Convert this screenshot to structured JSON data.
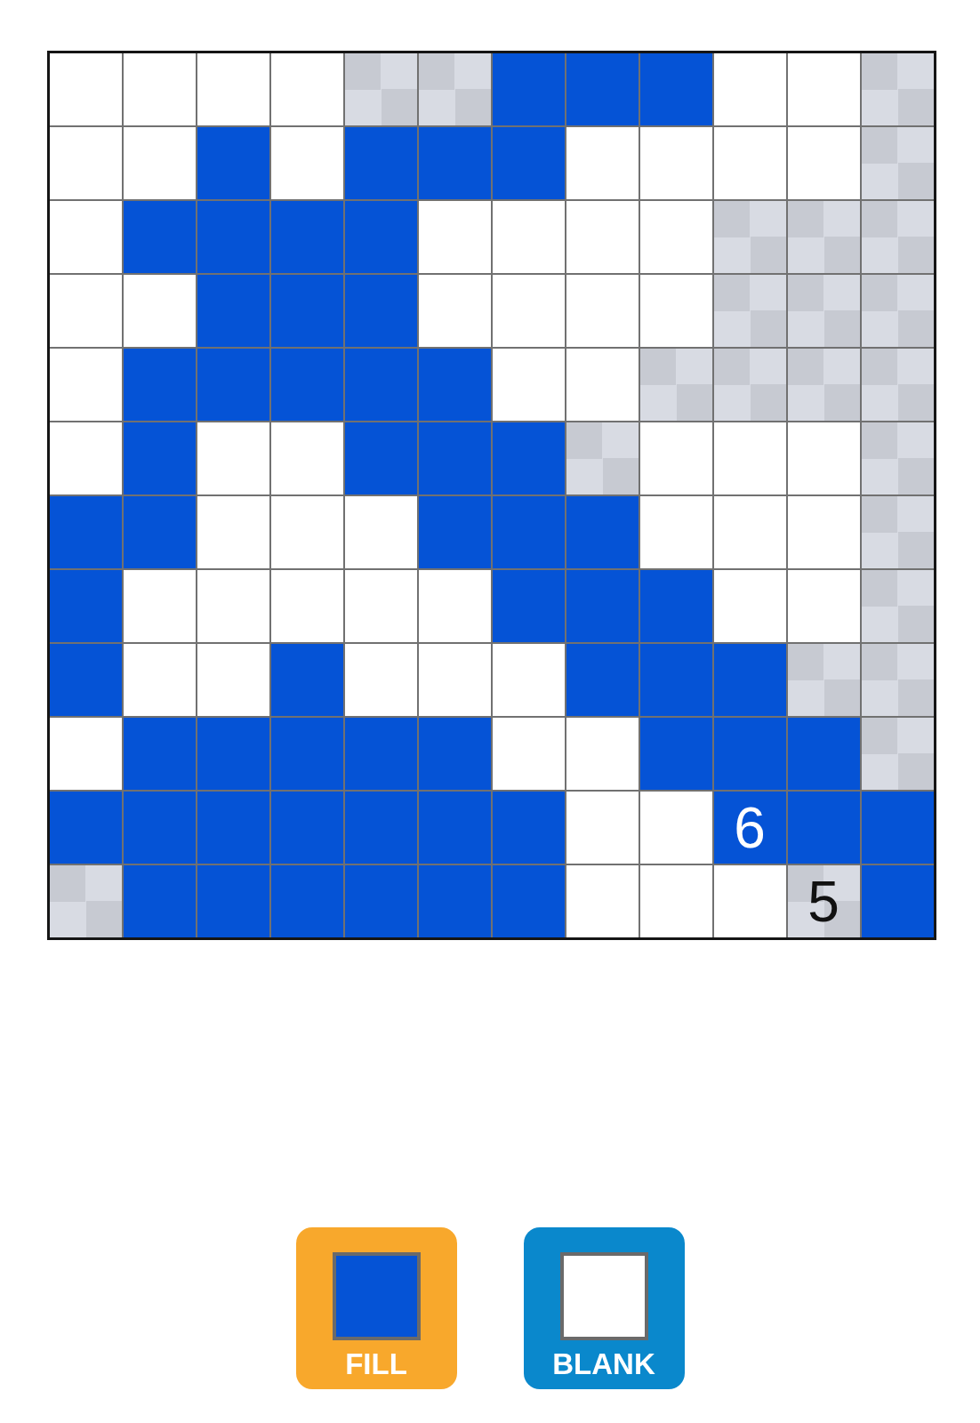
{
  "grid": {
    "rows": [
      {
        "cells": [
          {
            "kind": "empty"
          },
          {
            "kind": "empty"
          },
          {
            "kind": "empty"
          },
          {
            "kind": "empty"
          },
          {
            "kind": "unknown"
          },
          {
            "kind": "unknown"
          },
          {
            "kind": "filled"
          },
          {
            "kind": "filled"
          },
          {
            "kind": "filled"
          },
          {
            "kind": "empty"
          },
          {
            "kind": "empty"
          },
          {
            "kind": "unknown"
          }
        ]
      },
      {
        "cells": [
          {
            "kind": "empty"
          },
          {
            "kind": "empty"
          },
          {
            "kind": "filled"
          },
          {
            "kind": "empty"
          },
          {
            "kind": "filled"
          },
          {
            "kind": "filled"
          },
          {
            "kind": "filled"
          },
          {
            "kind": "empty"
          },
          {
            "kind": "empty"
          },
          {
            "kind": "empty"
          },
          {
            "kind": "empty"
          },
          {
            "kind": "unknown"
          }
        ]
      },
      {
        "cells": [
          {
            "kind": "empty"
          },
          {
            "kind": "filled"
          },
          {
            "kind": "filled"
          },
          {
            "kind": "filled"
          },
          {
            "kind": "filled"
          },
          {
            "kind": "empty"
          },
          {
            "kind": "empty"
          },
          {
            "kind": "empty"
          },
          {
            "kind": "empty"
          },
          {
            "kind": "unknown"
          },
          {
            "kind": "unknown"
          },
          {
            "kind": "unknown"
          }
        ]
      },
      {
        "cells": [
          {
            "kind": "empty"
          },
          {
            "kind": "empty"
          },
          {
            "kind": "filled"
          },
          {
            "kind": "filled"
          },
          {
            "kind": "filled"
          },
          {
            "kind": "empty"
          },
          {
            "kind": "empty"
          },
          {
            "kind": "empty"
          },
          {
            "kind": "empty"
          },
          {
            "kind": "unknown"
          },
          {
            "kind": "unknown"
          },
          {
            "kind": "unknown"
          }
        ]
      },
      {
        "cells": [
          {
            "kind": "empty"
          },
          {
            "kind": "filled"
          },
          {
            "kind": "filled"
          },
          {
            "kind": "filled"
          },
          {
            "kind": "filled"
          },
          {
            "kind": "filled"
          },
          {
            "kind": "empty"
          },
          {
            "kind": "empty"
          },
          {
            "kind": "unknown"
          },
          {
            "kind": "unknown"
          },
          {
            "kind": "unknown"
          },
          {
            "kind": "unknown"
          }
        ]
      },
      {
        "cells": [
          {
            "kind": "empty"
          },
          {
            "kind": "filled"
          },
          {
            "kind": "empty"
          },
          {
            "kind": "empty"
          },
          {
            "kind": "filled"
          },
          {
            "kind": "filled"
          },
          {
            "kind": "filled"
          },
          {
            "kind": "unknown"
          },
          {
            "kind": "empty"
          },
          {
            "kind": "empty"
          },
          {
            "kind": "empty"
          },
          {
            "kind": "unknown"
          }
        ]
      },
      {
        "cells": [
          {
            "kind": "filled"
          },
          {
            "kind": "filled"
          },
          {
            "kind": "empty"
          },
          {
            "kind": "empty"
          },
          {
            "kind": "empty"
          },
          {
            "kind": "filled"
          },
          {
            "kind": "filled"
          },
          {
            "kind": "filled"
          },
          {
            "kind": "empty"
          },
          {
            "kind": "empty"
          },
          {
            "kind": "empty"
          },
          {
            "kind": "unknown"
          }
        ]
      },
      {
        "cells": [
          {
            "kind": "filled"
          },
          {
            "kind": "empty"
          },
          {
            "kind": "empty"
          },
          {
            "kind": "empty"
          },
          {
            "kind": "empty"
          },
          {
            "kind": "empty"
          },
          {
            "kind": "filled"
          },
          {
            "kind": "filled"
          },
          {
            "kind": "filled"
          },
          {
            "kind": "empty"
          },
          {
            "kind": "empty"
          },
          {
            "kind": "unknown"
          }
        ]
      },
      {
        "cells": [
          {
            "kind": "filled"
          },
          {
            "kind": "empty"
          },
          {
            "kind": "empty"
          },
          {
            "kind": "filled"
          },
          {
            "kind": "empty"
          },
          {
            "kind": "empty"
          },
          {
            "kind": "empty"
          },
          {
            "kind": "filled"
          },
          {
            "kind": "filled"
          },
          {
            "kind": "filled"
          },
          {
            "kind": "unknown"
          },
          {
            "kind": "unknown"
          }
        ]
      },
      {
        "cells": [
          {
            "kind": "empty"
          },
          {
            "kind": "filled"
          },
          {
            "kind": "filled"
          },
          {
            "kind": "filled"
          },
          {
            "kind": "filled"
          },
          {
            "kind": "filled"
          },
          {
            "kind": "empty"
          },
          {
            "kind": "empty"
          },
          {
            "kind": "filled"
          },
          {
            "kind": "filled"
          },
          {
            "kind": "filled"
          },
          {
            "kind": "unknown"
          }
        ]
      },
      {
        "cells": [
          {
            "kind": "filled"
          },
          {
            "kind": "filled"
          },
          {
            "kind": "filled"
          },
          {
            "kind": "filled"
          },
          {
            "kind": "filled"
          },
          {
            "kind": "filled"
          },
          {
            "kind": "filled"
          },
          {
            "kind": "empty"
          },
          {
            "kind": "empty"
          },
          {
            "kind": "filled",
            "number": "6"
          },
          {
            "kind": "filled"
          },
          {
            "kind": "filled"
          }
        ]
      },
      {
        "cells": [
          {
            "kind": "unknown"
          },
          {
            "kind": "filled"
          },
          {
            "kind": "filled"
          },
          {
            "kind": "filled"
          },
          {
            "kind": "filled"
          },
          {
            "kind": "filled"
          },
          {
            "kind": "filled"
          },
          {
            "kind": "empty"
          },
          {
            "kind": "empty"
          },
          {
            "kind": "empty"
          },
          {
            "kind": "unknown",
            "number": "5"
          },
          {
            "kind": "filled"
          }
        ]
      }
    ]
  },
  "mode_buttons": [
    {
      "kind": "fill",
      "label": "FILL",
      "selected": true
    },
    {
      "kind": "blank",
      "label": "BLANK",
      "selected": false
    }
  ]
}
